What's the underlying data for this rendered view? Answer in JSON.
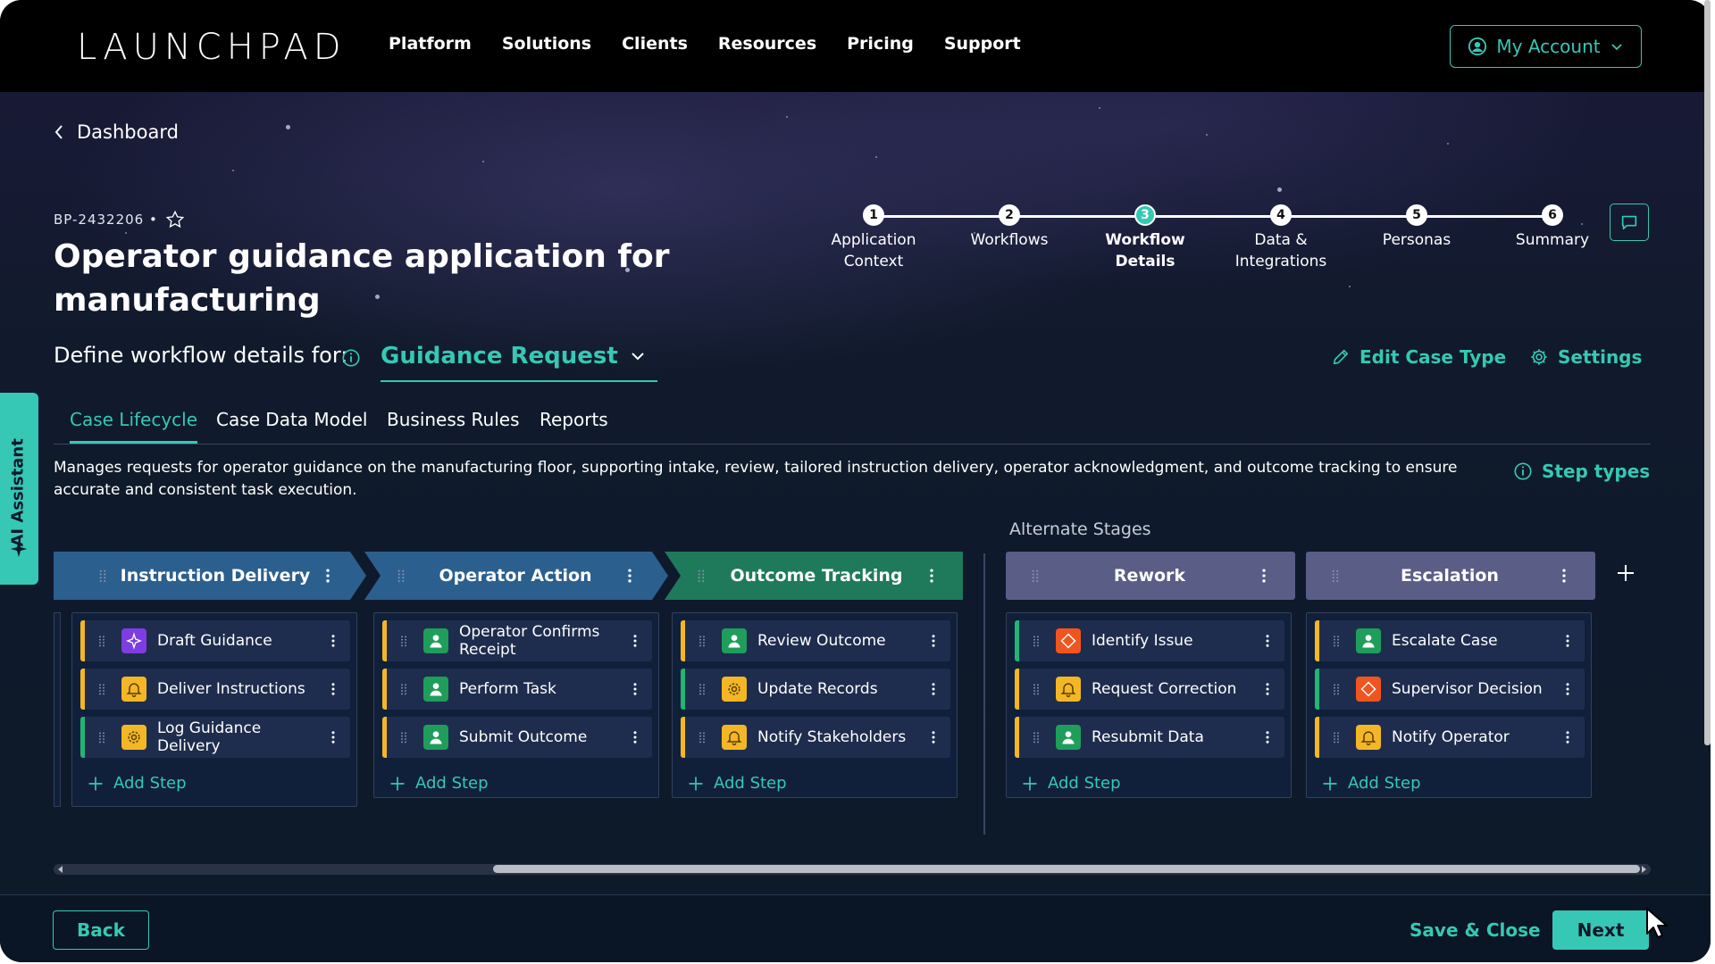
{
  "brand": {
    "logo": "LAUNCHPAD"
  },
  "nav": {
    "links": [
      "Platform",
      "Solutions",
      "Clients",
      "Resources",
      "Pricing",
      "Support"
    ],
    "account_label": "My Account"
  },
  "breadcrumb": {
    "label": "Dashboard"
  },
  "case": {
    "id": "BP-2432206 •",
    "title": "Operator guidance application for manufacturing"
  },
  "stepper": {
    "steps": [
      {
        "num": "1",
        "label": "Application Context"
      },
      {
        "num": "2",
        "label": "Workflows"
      },
      {
        "num": "3",
        "label": "Workflow Details"
      },
      {
        "num": "4",
        "label": "Data & Integrations"
      },
      {
        "num": "5",
        "label": "Personas"
      },
      {
        "num": "6",
        "label": "Summary"
      }
    ],
    "active": 3
  },
  "define": {
    "label": "Define workflow details for:",
    "case_type": "Guidance Request",
    "edit_label": "Edit Case Type",
    "settings_label": "Settings"
  },
  "tabs": [
    "Case Lifecycle",
    "Case Data Model",
    "Business Rules",
    "Reports"
  ],
  "description": "Manages requests for operator guidance on the manufacturing floor, supporting intake, review, tailored instruction delivery, operator acknowledgment, and outcome tracking to ensure accurate and consistent task execution.",
  "step_types_label": "Step types",
  "ai_assistant_label": "AI Assistant",
  "alternate_label": "Alternate Stages",
  "add_step_label": "Add Step",
  "stages": [
    {
      "title": "Instruction Delivery",
      "steps": [
        {
          "label": "Draft Guidance",
          "icon": "sparkle-icon"
        },
        {
          "label": "Deliver Instructions",
          "icon": "bell-icon"
        },
        {
          "label": "Log Guidance Delivery",
          "icon": "gear-icon"
        }
      ]
    },
    {
      "title": "Operator Action",
      "steps": [
        {
          "label": "Operator Confirms Receipt",
          "icon": "user-icon"
        },
        {
          "label": "Perform Task",
          "icon": "user-icon"
        },
        {
          "label": "Submit Outcome",
          "icon": "user-icon"
        }
      ]
    },
    {
      "title": "Outcome Tracking",
      "steps": [
        {
          "label": "Review Outcome",
          "icon": "user-icon"
        },
        {
          "label": "Update Records",
          "icon": "gear-icon"
        },
        {
          "label": "Notify Stakeholders",
          "icon": "bell-icon"
        }
      ]
    }
  ],
  "alternate_stages": [
    {
      "title": "Rework",
      "steps": [
        {
          "label": "Identify Issue",
          "icon": "decision-icon"
        },
        {
          "label": "Request Correction",
          "icon": "bell-icon"
        },
        {
          "label": "Resubmit Data",
          "icon": "user-icon"
        }
      ]
    },
    {
      "title": "Escalation",
      "steps": [
        {
          "label": "Escalate Case",
          "icon": "user-icon"
        },
        {
          "label": "Supervisor Decision",
          "icon": "decision-icon"
        },
        {
          "label": "Notify Operator",
          "icon": "bell-icon"
        }
      ]
    }
  ],
  "footer": {
    "back": "Back",
    "save_close": "Save & Close",
    "next": "Next"
  },
  "colors": {
    "accent": "#36c8b4",
    "stage_blue": "#2b5f8e",
    "stage_green": "#1e7a5a",
    "stage_alt": "#5a5d86"
  }
}
